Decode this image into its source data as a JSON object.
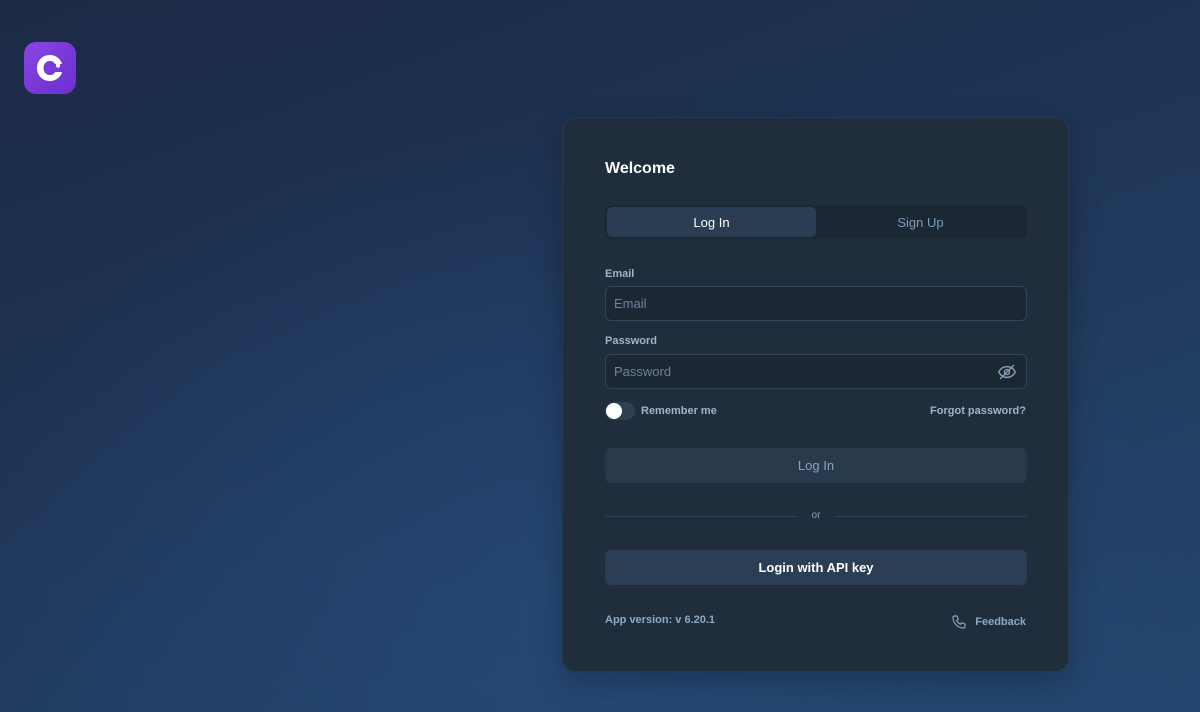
{
  "brand": {
    "logo_icon": "brand-logo-icon",
    "accent": "#7c3aed"
  },
  "card": {
    "title": "Welcome",
    "tabs": [
      {
        "label": "Log In",
        "active": true
      },
      {
        "label": "Sign Up",
        "active": false
      }
    ],
    "email": {
      "label": "Email",
      "placeholder": "Email",
      "value": ""
    },
    "password": {
      "label": "Password",
      "placeholder": "Password",
      "value": "",
      "toggle_icon": "eye-off-icon"
    },
    "remember": {
      "label": "Remember me",
      "checked": false
    },
    "forgot_label": "Forgot password?",
    "login_button": "Log In",
    "divider_text": "or",
    "api_button": "Login with API key",
    "version": "App version: v 6.20.1",
    "feedback": {
      "label": "Feedback",
      "icon": "phone-icon"
    }
  }
}
